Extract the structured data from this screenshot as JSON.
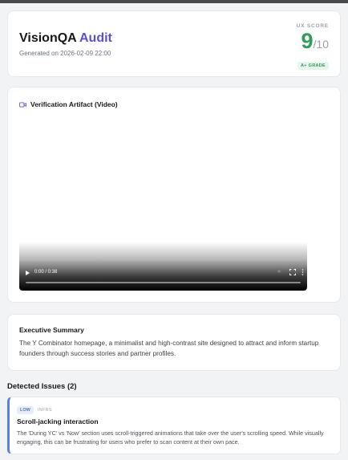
{
  "header": {
    "title_main": "VisionQA",
    "title_accent": "Audit",
    "generated": "Generated on 2026-02-09 22:00",
    "score_label": "UX SCORE",
    "score": "9",
    "score_max": "/10",
    "grade": "A+ GRADE"
  },
  "video": {
    "heading": "Verification Artifact (Video)",
    "icon": "video-camera-icon",
    "time": "0:00 / 0:38",
    "progress": 0
  },
  "summary": {
    "title": "Executive Summary",
    "text": "The Y Combinator homepage, a minimalist and high-contrast site designed to attract and inform startup founders through success stories and partner profiles."
  },
  "issues": {
    "title": "Detected Issues (2)",
    "items": [
      {
        "severity": "LOW",
        "category": "INFRS",
        "title": "Scroll-jacking interaction",
        "text": "The 'During YC' vs 'Now' section uses scroll-triggered animations that take over the user's scrolling speed. While visually engaging, this can be frustrating for users who prefer to scan content at their own pace."
      }
    ]
  },
  "colors": {
    "accent": "#5b4fd6",
    "score_green": "#2e9d55",
    "issue_border": "#5b7fe0"
  }
}
